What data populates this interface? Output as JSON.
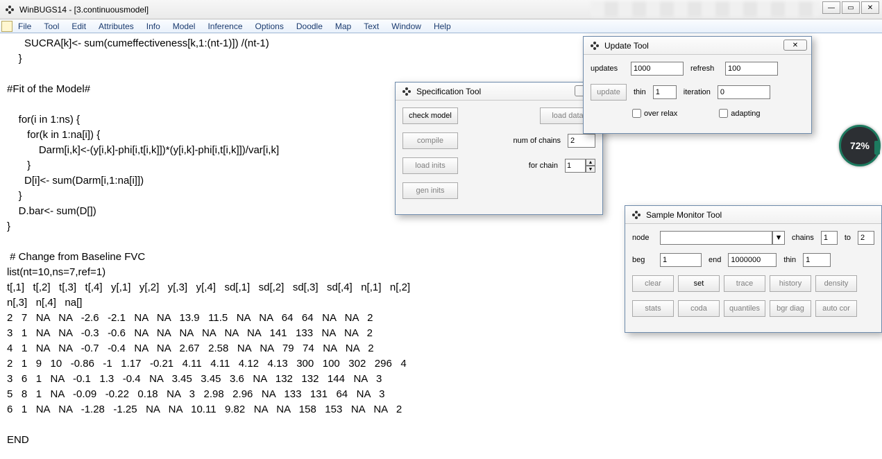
{
  "title": "WinBUGS14 - [3.continuousmodel]",
  "menu": [
    "File",
    "Tool",
    "Edit",
    "Attributes",
    "Info",
    "Model",
    "Inference",
    "Options",
    "Doodle",
    "Map",
    "Text",
    "Window",
    "Help"
  ],
  "code": "      SUCRA[k]<- sum(cumeffectiveness[k,1:(nt-1)]) /(nt-1)\n    }\n\n#Fit of the Model#\n\n    for(i in 1:ns) {\n       for(k in 1:na[i]) {\n           Darm[i,k]<-(y[i,k]-phi[i,t[i,k]])*(y[i,k]-phi[i,t[i,k]])/var[i,k]\n       }\n      D[i]<- sum(Darm[i,1:na[i]])\n    }\n    D.bar<- sum(D[])\n}\n\n # Change from Baseline FVC\nlist(nt=10,ns=7,ref=1)\nt[,1]   t[,2]   t[,3]   t[,4]   y[,1]   y[,2]   y[,3]   y[,4]   sd[,1]   sd[,2]   sd[,3]   sd[,4]   n[,1]   n[,2]   \nn[,3]   n[,4]   na[]\n2   7   NA   NA   -2.6   -2.1   NA   NA   13.9   11.5   NA   NA   64   64   NA   NA   2\n3   1   NA   NA   -0.3   -0.6   NA   NA   NA   NA   NA   NA   141   133   NA   NA   2\n4   1   NA   NA   -0.7   -0.4   NA   NA   2.67   2.58   NA   NA   79   74   NA   NA   2\n2   1   9   10   -0.86   -1   1.17   -0.21   4.11   4.11   4.12   4.13   300   100   302   296   4\n3   6   1   NA   -0.1   1.3   -0.4   NA   3.45   3.45   3.6   NA   132   132   144   NA   3\n5   8   1   NA   -0.09   -0.22   0.18   NA   3   2.98   2.96   NA   133   131   64   NA   3\n6   1   NA   NA   -1.28   -1.25   NA   NA   10.11   9.82   NA   NA   158   153   NA   NA   2\n\nEND",
  "spec": {
    "title": "Specification Tool",
    "check_model": "check model",
    "load_data": "load data",
    "compile": "compile",
    "num_chains_lbl": "num of chains",
    "num_chains_val": "2",
    "load_inits": "load inits",
    "for_chain_lbl": "for chain",
    "for_chain_val": "1",
    "gen_inits": "gen inits"
  },
  "update": {
    "title": "Update Tool",
    "updates_lbl": "updates",
    "updates_val": "1000",
    "refresh_lbl": "refresh",
    "refresh_val": "100",
    "update_btn": "update",
    "thin_lbl": "thin",
    "thin_val": "1",
    "iteration_lbl": "iteration",
    "iteration_val": "0",
    "over_relax": "over relax",
    "adapting": "adapting"
  },
  "sample": {
    "title": "Sample Monitor Tool",
    "node_lbl": "node",
    "chains_lbl": "chains",
    "chains_from": "1",
    "chains_to_lbl": "to",
    "chains_to": "2",
    "beg_lbl": "beg",
    "beg_val": "1",
    "end_lbl": "end",
    "end_val": "1000000",
    "thin_lbl": "thin",
    "thin_val": "1",
    "btns": [
      "clear",
      "set",
      "trace",
      "history",
      "density",
      "stats",
      "coda",
      "quantiles",
      "bgr diag",
      "auto cor"
    ]
  },
  "badge": "72%"
}
